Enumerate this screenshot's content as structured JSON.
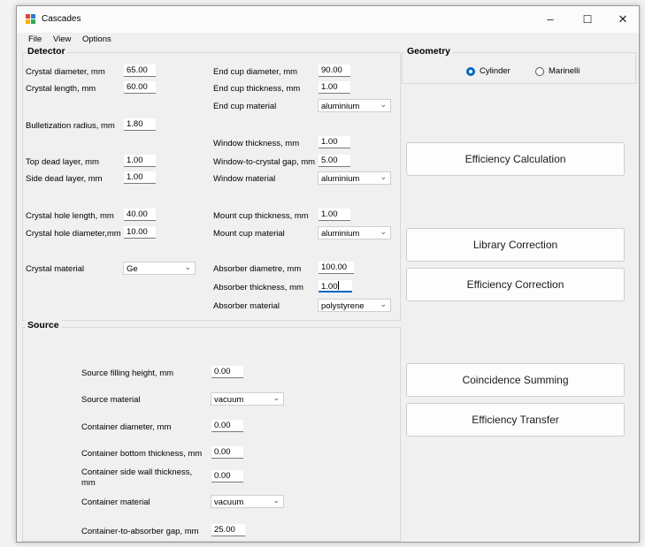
{
  "window": {
    "title": "Cascades",
    "minimize": "–",
    "maximize": "☐",
    "close": "✕"
  },
  "menu": {
    "file": "File",
    "view": "View",
    "options": "Options"
  },
  "detector": {
    "title": "Detector",
    "crystal_diameter": {
      "label": "Crystal diameter, mm",
      "value": "65.00"
    },
    "crystal_length": {
      "label": "Crystal length, mm",
      "value": "60.00"
    },
    "bulletization_radius": {
      "label": "Bulletization radius, mm",
      "value": "1.80"
    },
    "top_dead_layer": {
      "label": "Top dead layer, mm",
      "value": "1.00"
    },
    "side_dead_layer": {
      "label": "Side dead layer, mm",
      "value": "1.00"
    },
    "crystal_hole_length": {
      "label": "Crystal hole length, mm",
      "value": "40.00"
    },
    "crystal_hole_diameter": {
      "label": "Crystal hole diameter,mm",
      "value": "10.00"
    },
    "crystal_material": {
      "label": "Crystal material",
      "value": "Ge"
    },
    "end_cup_diameter": {
      "label": "End cup diameter, mm",
      "value": "90.00"
    },
    "end_cup_thickness": {
      "label": "End cup thickness, mm",
      "value": "1.00"
    },
    "end_cup_material": {
      "label": "End cup material",
      "value": "aluminium"
    },
    "window_thickness": {
      "label": "Window thickness, mm",
      "value": "1.00"
    },
    "window_gap": {
      "label": "Window-to-crystal gap, mm",
      "value": "5.00"
    },
    "window_material": {
      "label": "Window material",
      "value": "aluminium"
    },
    "mount_cup_thickness": {
      "label": "Mount cup thickness, mm",
      "value": "1.00"
    },
    "mount_cup_material": {
      "label": "Mount cup material",
      "value": "aluminium"
    },
    "absorber_diameter": {
      "label": "Absorber diametre, mm",
      "value": "100.00"
    },
    "absorber_thickness": {
      "label": "Absorber thickness, mm",
      "value": "1.00"
    },
    "absorber_material": {
      "label": "Absorber material",
      "value": "polystyrene"
    }
  },
  "geometry": {
    "title": "Geometry",
    "options": [
      {
        "label": "Cylinder",
        "selected": true
      },
      {
        "label": "Marinelli",
        "selected": false
      }
    ]
  },
  "source": {
    "title": "Source",
    "filling_height": {
      "label": "Source filling height, mm",
      "value": "0.00"
    },
    "material": {
      "label": "Source material",
      "value": "vacuum"
    },
    "container_diameter": {
      "label": "Container diameter, mm",
      "value": "0.00"
    },
    "container_bottom": {
      "label": "Container bottom thickness, mm",
      "value": "0.00"
    },
    "container_side_wall_line1": "Container side wall thickness,",
    "container_side_wall_line2": "mm",
    "container_side_wall_value": "0.00",
    "container_material": {
      "label": "Container material",
      "value": "vacuum"
    },
    "absorber_gap": {
      "label": "Container-to-absorber gap, mm",
      "value": "25.00"
    }
  },
  "buttons": {
    "efficiency_calculation": "Efficiency Calculation",
    "library_correction": "Library Correction",
    "efficiency_correction": "Efficiency Correction",
    "coincidence_summing": "Coincidence Summing",
    "efficiency_transfer": "Efficiency Transfer"
  },
  "colors": {
    "accent": "#0067c0",
    "icon_red": "#e34234",
    "icon_blue": "#2b79d8",
    "icon_yellow": "#f4b400",
    "icon_green": "#34a853"
  }
}
